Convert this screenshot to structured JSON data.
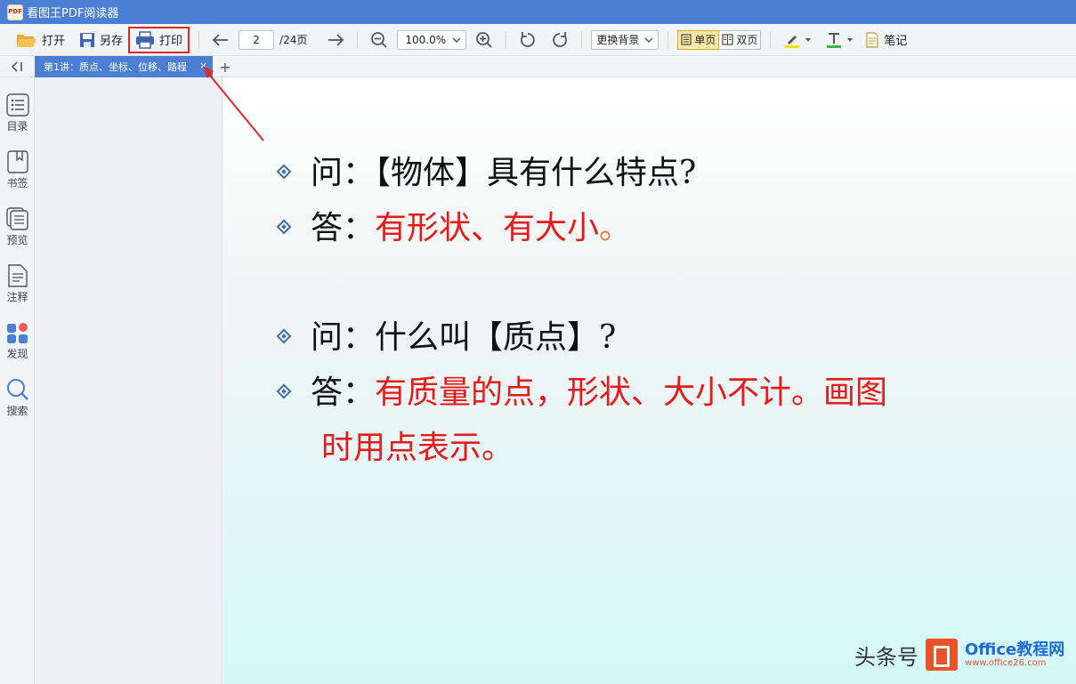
{
  "window": {
    "title": "看图王PDF阅读器",
    "logo_text": "PDF"
  },
  "toolbar": {
    "open_label": "打开",
    "saveas_label": "另存",
    "print_label": "打印",
    "page_current": "2",
    "page_total": "/24页",
    "zoom_value": "100.0%",
    "background_label": "更换背景",
    "single_page_label": "单页",
    "double_page_label": "双页",
    "notes_label": "笔记"
  },
  "tabs": {
    "active_doc": "第1讲：质点、坐标、位移、路程",
    "close": "×",
    "add": "+"
  },
  "rail": {
    "toc": "目录",
    "bookmark": "书签",
    "preview": "预览",
    "annotation": "注释",
    "discover": "发现",
    "search": "搜索"
  },
  "document": {
    "q1": "问：【物体】具有什么特点?",
    "a1_prefix": "答：",
    "a1_text": "有形状、有大小",
    "a1_end": "。",
    "q2": "问：什么叫【质点】?",
    "a2_prefix": "答：",
    "a2_text": "有质量的点，形状、大小不计。画图",
    "a2_text2": "时用点表示。"
  },
  "watermark": {
    "source": "头条号",
    "site": "Office教程网",
    "url": "www.office26.com"
  },
  "colors": {
    "titlebar": "#4a7fd3",
    "answer_red": "#e31b1b",
    "highlight_border": "#e0282a"
  }
}
